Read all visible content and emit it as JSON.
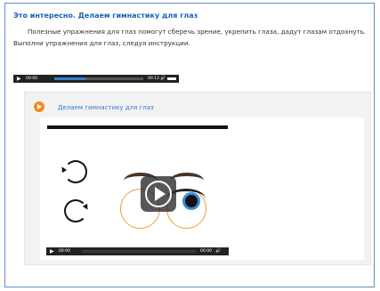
{
  "lesson": {
    "title": "Это интересно. Делаем гимнастику для глаз",
    "intro_line1": "Полезные упражнения для глаз помогут сберечь зрение, укрепить глаза, дадут глазам отдохнуть.",
    "intro_line2": "Выполни упражнения для глаз, следуя инструкции."
  },
  "audio": {
    "play_icon": "play-icon",
    "current_time": "00:00",
    "duration": "00:12",
    "progress": 0.35,
    "volume_icon": "volume-icon",
    "accent_color": "#2f7fd0"
  },
  "video_panel": {
    "icon": "orange-play-icon",
    "title": "Делаем гимнастику для глаз",
    "player": {
      "play_icon": "play-icon",
      "current_time": "00:00",
      "duration": "00:00",
      "volume_icon": "volume-icon"
    }
  },
  "colors": {
    "title_blue": "#1a62b5",
    "panel_icon_orange": "#f28c1e",
    "frame_border": "#5b8fd0"
  }
}
